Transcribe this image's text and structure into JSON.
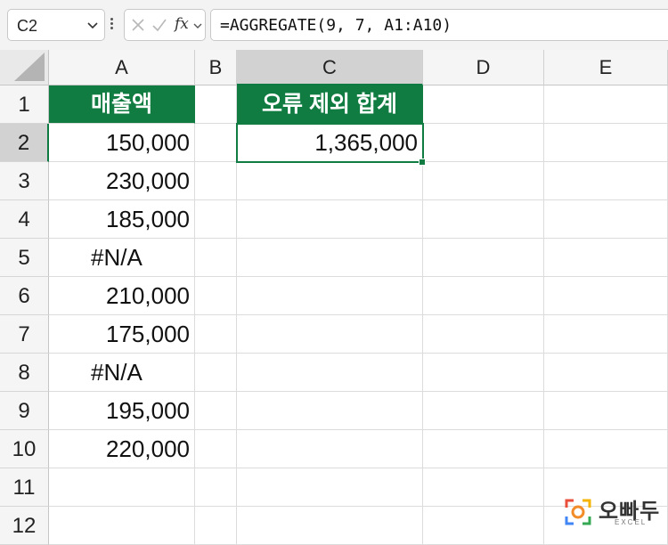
{
  "formula_bar": {
    "name_box": "C2",
    "fx_label": "fx",
    "formula": "=AGGREGATE(9, 7, A1:A10)"
  },
  "columns": [
    "A",
    "B",
    "C",
    "D",
    "E"
  ],
  "rows": [
    "1",
    "2",
    "3",
    "4",
    "5",
    "6",
    "7",
    "8",
    "9",
    "10",
    "11",
    "12"
  ],
  "cells": {
    "A1": "매출액",
    "A2": "150,000",
    "A3": "230,000",
    "A4": "185,000",
    "A5": "#N/A",
    "A6": "210,000",
    "A7": "175,000",
    "A8": "#N/A",
    "A9": "195,000",
    "A10": "220,000",
    "C1": "오류 제외 합계",
    "C2": "1,365,000"
  },
  "selected_cell": "C2",
  "colors": {
    "header_fill": "#107c41",
    "selection": "#107c41"
  },
  "watermark": {
    "text": "오빠두",
    "sub": "EXCEL"
  }
}
